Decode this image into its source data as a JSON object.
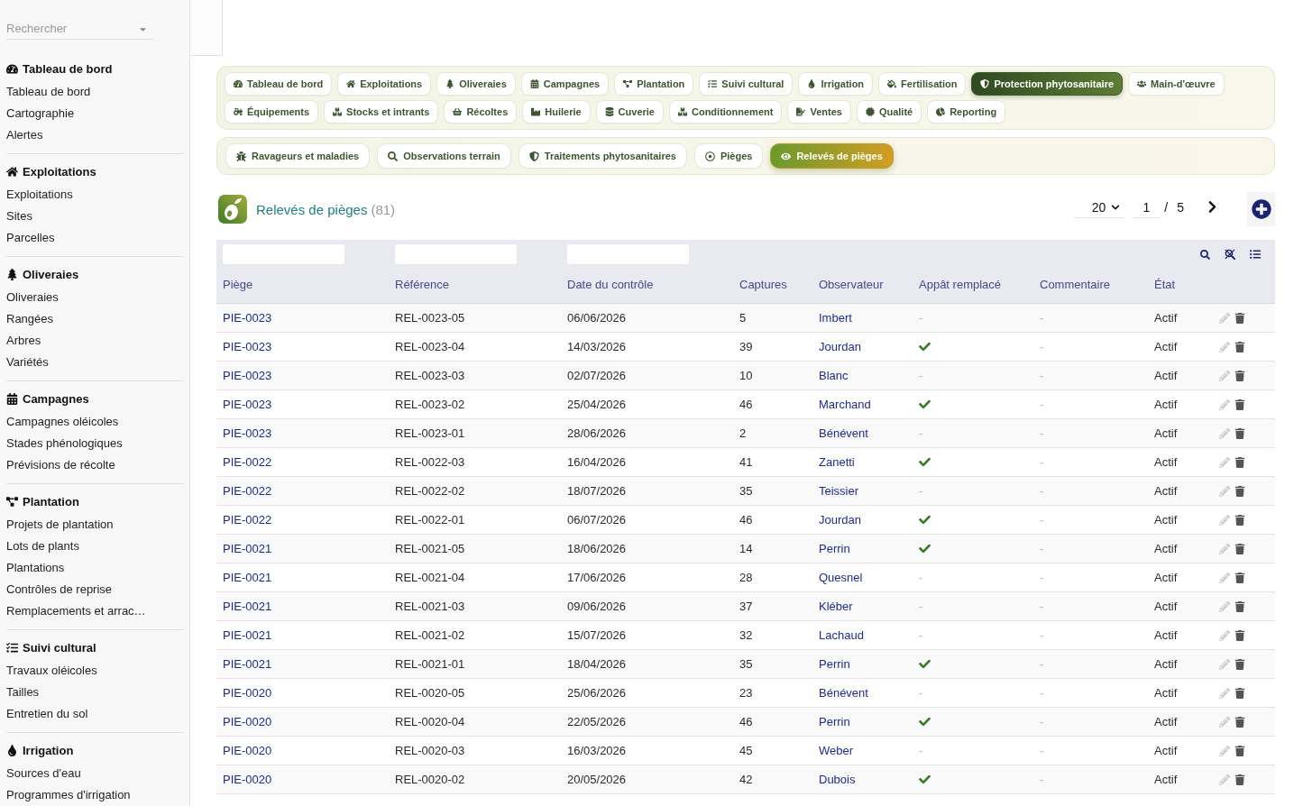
{
  "sidebar": {
    "search": {
      "placeholder": "Rechercher"
    },
    "sections": [
      {
        "title": "Tableau de bord",
        "items": [
          "Tableau de bord",
          "Cartographie",
          "Alertes"
        ]
      },
      {
        "title": "Exploitations",
        "items": [
          "Exploitations",
          "Sites",
          "Parcelles"
        ]
      },
      {
        "title": "Oliveraies",
        "items": [
          "Oliveraies",
          "Rangées",
          "Arbres",
          "Variétés"
        ]
      },
      {
        "title": "Campagnes",
        "items": [
          "Campagnes oléicoles",
          "Stades phénologiques",
          "Prévisions de récolte"
        ]
      },
      {
        "title": "Plantation",
        "items": [
          "Projets de plantation",
          "Lots de plants",
          "Plantations",
          "Contrôles de reprise",
          "Remplacements et arrac…"
        ]
      },
      {
        "title": "Suivi cultural",
        "items": [
          "Travaux oléicoles",
          "Tailles",
          "Entretien du sol"
        ]
      },
      {
        "title": "Irrigation",
        "items": [
          "Sources d'eau",
          "Programmes d'irrigation"
        ]
      }
    ]
  },
  "module_tabs": [
    {
      "tabs": [
        {
          "label": "Tableau de bord",
          "selected": false
        },
        {
          "label": "Exploitations",
          "selected": false
        },
        {
          "label": "Oliveraies",
          "selected": false
        },
        {
          "label": "Campagnes",
          "selected": false
        },
        {
          "label": "Plantation",
          "selected": false
        },
        {
          "label": "Suivi cultural",
          "selected": false
        },
        {
          "label": "Irrigation",
          "selected": false
        },
        {
          "label": "Fertilisation",
          "selected": false
        },
        {
          "label": "Protection phytosanitaire",
          "selected": true
        },
        {
          "label": "Main-d'œuvre",
          "selected": false
        }
      ]
    },
    {
      "tabs": [
        {
          "label": "Équipements",
          "selected": false
        },
        {
          "label": "Stocks et intrants",
          "selected": false
        },
        {
          "label": "Récoltes",
          "selected": false
        },
        {
          "label": "Huilerie",
          "selected": false
        },
        {
          "label": "Cuverie",
          "selected": false
        },
        {
          "label": "Conditionnement",
          "selected": false
        },
        {
          "label": "Ventes",
          "selected": false
        },
        {
          "label": "Qualité",
          "selected": false
        },
        {
          "label": "Reporting",
          "selected": false
        }
      ]
    }
  ],
  "sub_tabs": [
    {
      "label": "Ravageurs et maladies",
      "selected": false
    },
    {
      "label": "Observations terrain",
      "selected": false
    },
    {
      "label": "Traitements phytosanitaires",
      "selected": false
    },
    {
      "label": "Pièges",
      "selected": false
    },
    {
      "label": "Relevés de pièges",
      "selected": true
    }
  ],
  "list_header": {
    "title": "Relevés de pièges",
    "count": "(81)",
    "pagination": {
      "page_size": "20",
      "page": "1",
      "separator": "/",
      "total_pages": "5"
    }
  },
  "table": {
    "columns": [
      {
        "label": "Piège",
        "filter": true
      },
      {
        "label": "Référence",
        "filter": true
      },
      {
        "label": "Date du contrôle",
        "filter": true
      },
      {
        "label": "Captures",
        "filter": false
      },
      {
        "label": "Observateur",
        "filter": false
      },
      {
        "label": "Appât remplacé",
        "filter": false
      },
      {
        "label": "Commentaire",
        "filter": false
      },
      {
        "label": "État",
        "filter": false
      }
    ],
    "rows": [
      {
        "trap": "PIE-0023",
        "reference": "REL-0023-05",
        "date": "06/06/2026",
        "captures": "5",
        "observer": "Imbert",
        "bait_replaced": false,
        "bait_text": "-",
        "comment": "-",
        "status": "Actif"
      },
      {
        "trap": "PIE-0023",
        "reference": "REL-0023-04",
        "date": "14/03/2026",
        "captures": "39",
        "observer": "Jourdan",
        "bait_replaced": true,
        "comment": "-",
        "status": "Actif"
      },
      {
        "trap": "PIE-0023",
        "reference": "REL-0023-03",
        "date": "02/07/2026",
        "captures": "10",
        "observer": "Blanc",
        "bait_replaced": false,
        "bait_text": "-",
        "comment": "-",
        "status": "Actif"
      },
      {
        "trap": "PIE-0023",
        "reference": "REL-0023-02",
        "date": "25/04/2026",
        "captures": "46",
        "observer": "Marchand",
        "bait_replaced": true,
        "comment": "-",
        "status": "Actif"
      },
      {
        "trap": "PIE-0023",
        "reference": "REL-0023-01",
        "date": "28/06/2026",
        "captures": "2",
        "observer": "Bénévent",
        "bait_replaced": false,
        "bait_text": "-",
        "comment": "-",
        "status": "Actif"
      },
      {
        "trap": "PIE-0022",
        "reference": "REL-0022-03",
        "date": "16/04/2026",
        "captures": "41",
        "observer": "Zanetti",
        "bait_replaced": true,
        "comment": "-",
        "status": "Actif"
      },
      {
        "trap": "PIE-0022",
        "reference": "REL-0022-02",
        "date": "18/07/2026",
        "captures": "35",
        "observer": "Teissier",
        "bait_replaced": false,
        "bait_text": "-",
        "comment": "-",
        "status": "Actif"
      },
      {
        "trap": "PIE-0022",
        "reference": "REL-0022-01",
        "date": "06/07/2026",
        "captures": "46",
        "observer": "Jourdan",
        "bait_replaced": true,
        "comment": "-",
        "status": "Actif"
      },
      {
        "trap": "PIE-0021",
        "reference": "REL-0021-05",
        "date": "18/06/2026",
        "captures": "14",
        "observer": "Perrin",
        "bait_replaced": true,
        "comment": "-",
        "status": "Actif"
      },
      {
        "trap": "PIE-0021",
        "reference": "REL-0021-04",
        "date": "17/06/2026",
        "captures": "28",
        "observer": "Quesnel",
        "bait_replaced": false,
        "bait_text": "-",
        "comment": "-",
        "status": "Actif"
      },
      {
        "trap": "PIE-0021",
        "reference": "REL-0021-03",
        "date": "09/06/2026",
        "captures": "37",
        "observer": "Kléber",
        "bait_replaced": false,
        "bait_text": "-",
        "comment": "-",
        "status": "Actif"
      },
      {
        "trap": "PIE-0021",
        "reference": "REL-0021-02",
        "date": "15/07/2026",
        "captures": "32",
        "observer": "Lachaud",
        "bait_replaced": false,
        "bait_text": "-",
        "comment": "-",
        "status": "Actif"
      },
      {
        "trap": "PIE-0021",
        "reference": "REL-0021-01",
        "date": "18/04/2026",
        "captures": "35",
        "observer": "Perrin",
        "bait_replaced": true,
        "comment": "-",
        "status": "Actif"
      },
      {
        "trap": "PIE-0020",
        "reference": "REL-0020-05",
        "date": "25/06/2026",
        "captures": "23",
        "observer": "Bénévent",
        "bait_replaced": false,
        "bait_text": "-",
        "comment": "-",
        "status": "Actif"
      },
      {
        "trap": "PIE-0020",
        "reference": "REL-0020-04",
        "date": "22/05/2026",
        "captures": "46",
        "observer": "Perrin",
        "bait_replaced": true,
        "comment": "-",
        "status": "Actif"
      },
      {
        "trap": "PIE-0020",
        "reference": "REL-0020-03",
        "date": "16/03/2026",
        "captures": "45",
        "observer": "Weber",
        "bait_replaced": false,
        "bait_text": "-",
        "comment": "-",
        "status": "Actif"
      },
      {
        "trap": "PIE-0020",
        "reference": "REL-0020-02",
        "date": "20/05/2026",
        "captures": "42",
        "observer": "Dubois",
        "bait_replaced": true,
        "comment": "-",
        "status": "Actif"
      }
    ]
  }
}
